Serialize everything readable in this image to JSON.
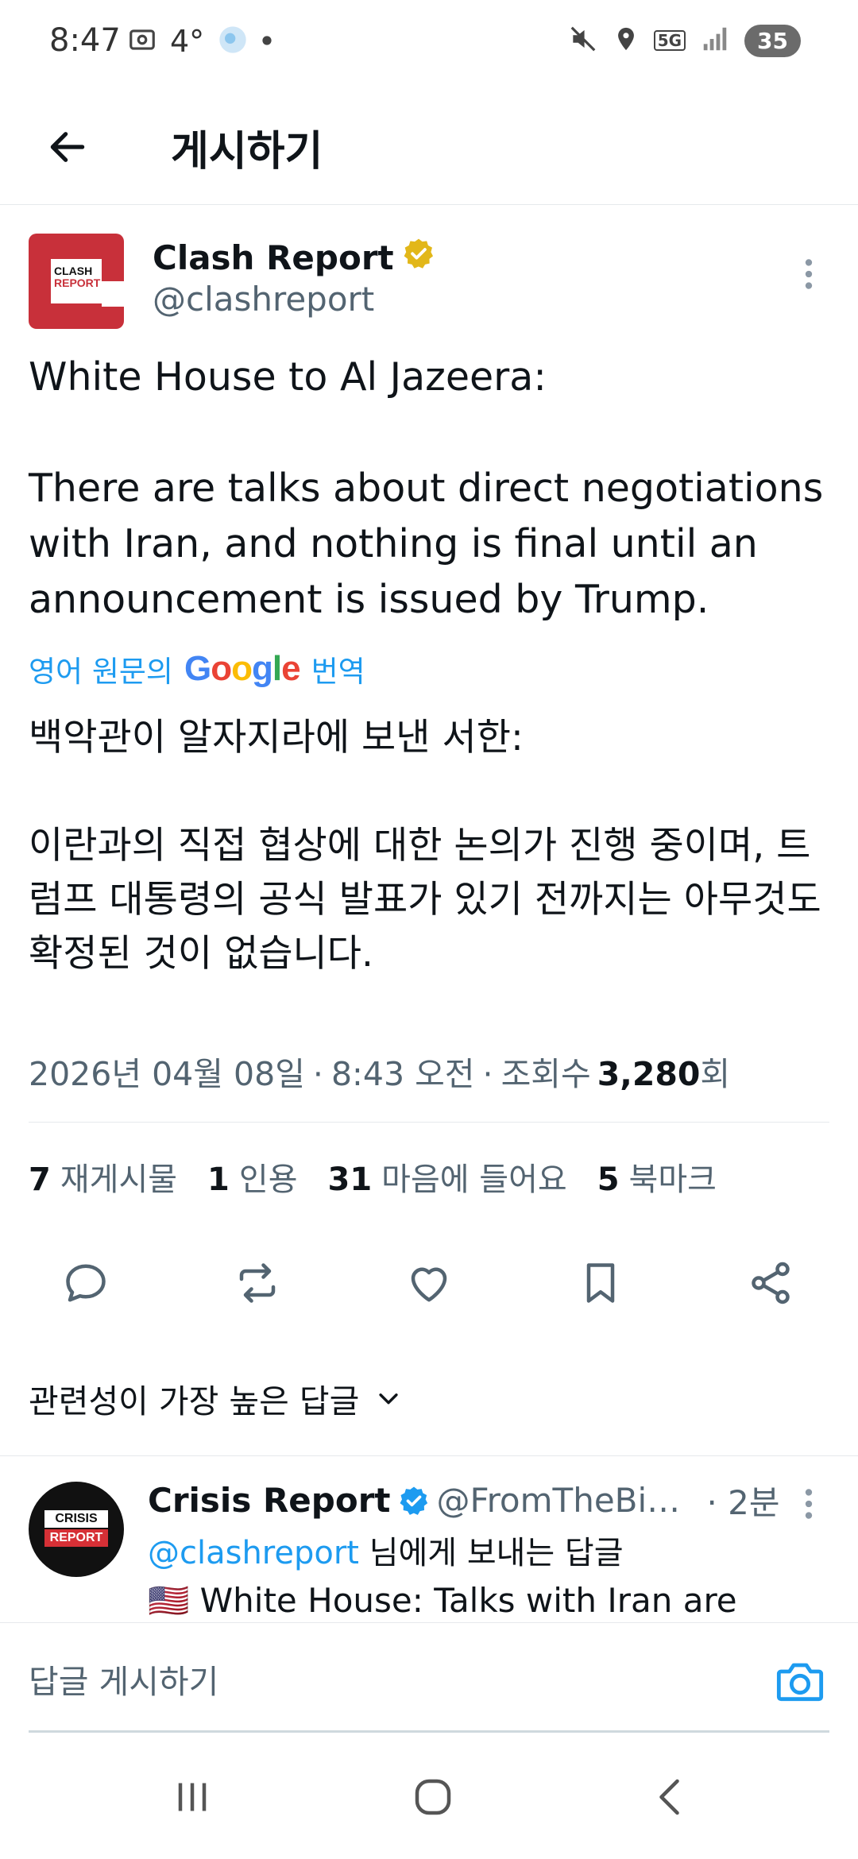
{
  "status_bar": {
    "time": "8:47",
    "temperature": "4°",
    "battery": "35",
    "network": "5G",
    "icons": [
      "screenshot-icon",
      "weather-icon",
      "dot-icon",
      "mute-icon",
      "location-icon",
      "5g-icon",
      "signal-icon",
      "battery-icon"
    ]
  },
  "header": {
    "title": "게시하기"
  },
  "tweet": {
    "author_name": "Clash Report",
    "author_handle": "@clashreport",
    "avatar_text_line1": "CLASH",
    "avatar_text_line2": "REPORT",
    "text": "White House to Al Jazeera:\n\nThere are talks about direct negotiations with Iran, and nothing is final until an announcement is issued by Trump.",
    "translate_prefix": "영어 원문의",
    "translate_brand": "Google",
    "translate_suffix": "번역",
    "translated_text": "백악관이 알자지라에 보낸 서한:\n\n이란과의 직접 협상에 대한 논의가 진행 중이며, 트럼프 대통령의 공식 발표가 있기 전까지는 아무것도 확정된 것이 없습니다.",
    "date": "2026년 04월 08일",
    "time": "8:43 오전",
    "views_label": "조회수",
    "views_count": "3,280",
    "views_suffix": "회",
    "separator": "·"
  },
  "stats": [
    {
      "num": "7",
      "label": "재게시물"
    },
    {
      "num": "1",
      "label": "인용"
    },
    {
      "num": "31",
      "label": "마음에 들어요"
    },
    {
      "num": "5",
      "label": "북마크"
    }
  ],
  "actions": [
    "reply-icon",
    "repost-icon",
    "like-icon",
    "bookmark-icon",
    "share-icon"
  ],
  "sort": {
    "label": "관련성이 가장 높은 답글"
  },
  "reply": {
    "author_name": "Crisis Report",
    "author_handle": "@FromTheBig...",
    "time": "· 2분",
    "reply_to_mention": "@clashreport",
    "reply_to_suffix": " 님에게 보내는 답글",
    "body": "🇺🇸 White House: Talks with Iran are",
    "avatar_line1": "CRISIS",
    "avatar_line2": "REPORT"
  },
  "composer": {
    "placeholder": "답글 게시하기"
  },
  "colors": {
    "accent": "#1d9bf0",
    "text": "#0f1419",
    "secondary": "#536471",
    "verified_gold": "#e2b719",
    "verified_blue": "#1d9bf0",
    "clash_red": "#c8303a"
  }
}
